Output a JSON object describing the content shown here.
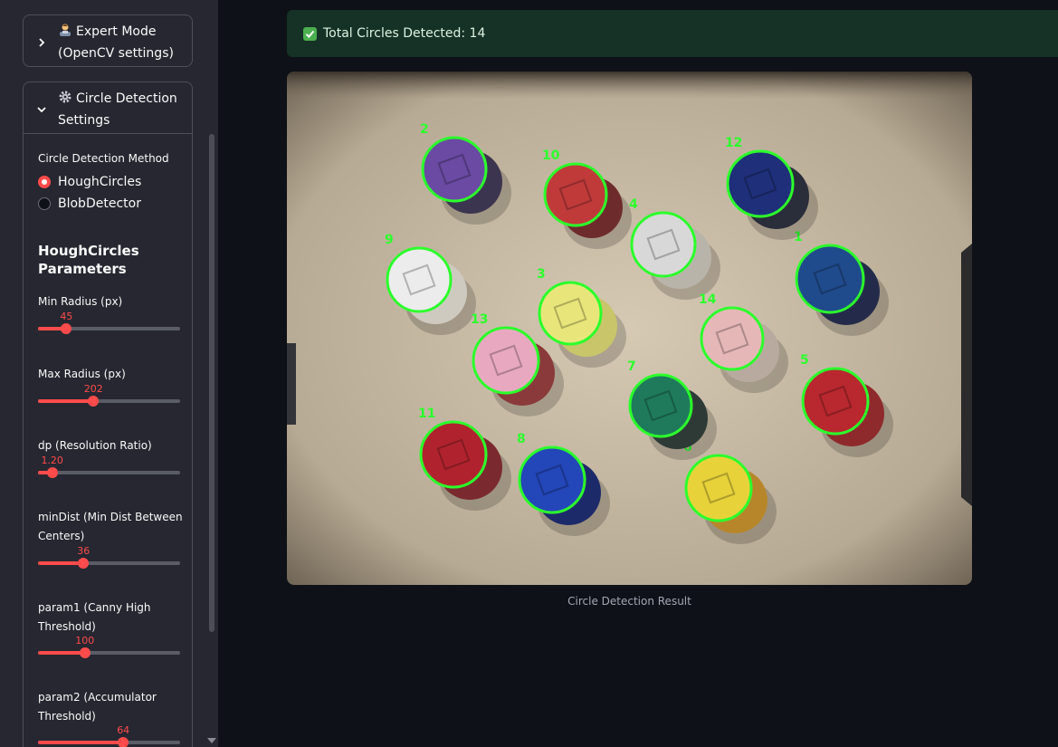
{
  "sidebar": {
    "expert_mode": {
      "label_line1": "Expert Mode",
      "label_line2": "(OpenCV settings)"
    },
    "circle_detection": {
      "label_line1": "Circle Detection",
      "label_line2": "Settings",
      "method_label": "Circle Detection Method",
      "methods": [
        {
          "label": "HoughCircles",
          "selected": true
        },
        {
          "label": "BlobDetector",
          "selected": false
        }
      ],
      "params_title_line1": "HoughCircles",
      "params_title_line2": "Parameters",
      "sliders": {
        "min_radius": {
          "label": "Min Radius (px)",
          "value": "45",
          "fraction": 0.2
        },
        "max_radius": {
          "label": "Max Radius (px)",
          "value": "202",
          "fraction": 0.39
        },
        "dp": {
          "label": "dp (Resolution Ratio)",
          "value": "1.20",
          "fraction": 0.1
        },
        "min_dist": {
          "label_line1": "minDist (Min Dist Between",
          "label_line2": "Centers)",
          "value": "36",
          "fraction": 0.32
        },
        "param1": {
          "label_line1": "param1 (Canny High",
          "label_line2": "Threshold)",
          "value": "100",
          "fraction": 0.33
        },
        "param2": {
          "label_line1": "param2 (Accumulator",
          "label_line2": "Threshold)",
          "value": "64",
          "fraction": 0.6
        }
      }
    }
  },
  "main": {
    "alert_text": "Total Circles Detected: 14",
    "caption": "Circle Detection Result"
  },
  "detections": [
    "1",
    "2",
    "3",
    "4",
    "5",
    "6",
    "7",
    "8",
    "9",
    "10",
    "11",
    "12",
    "13",
    "14"
  ],
  "colors": {
    "accent": "#ff4b4b",
    "detect": "#2cff2c",
    "success_bg": "#163125"
  }
}
